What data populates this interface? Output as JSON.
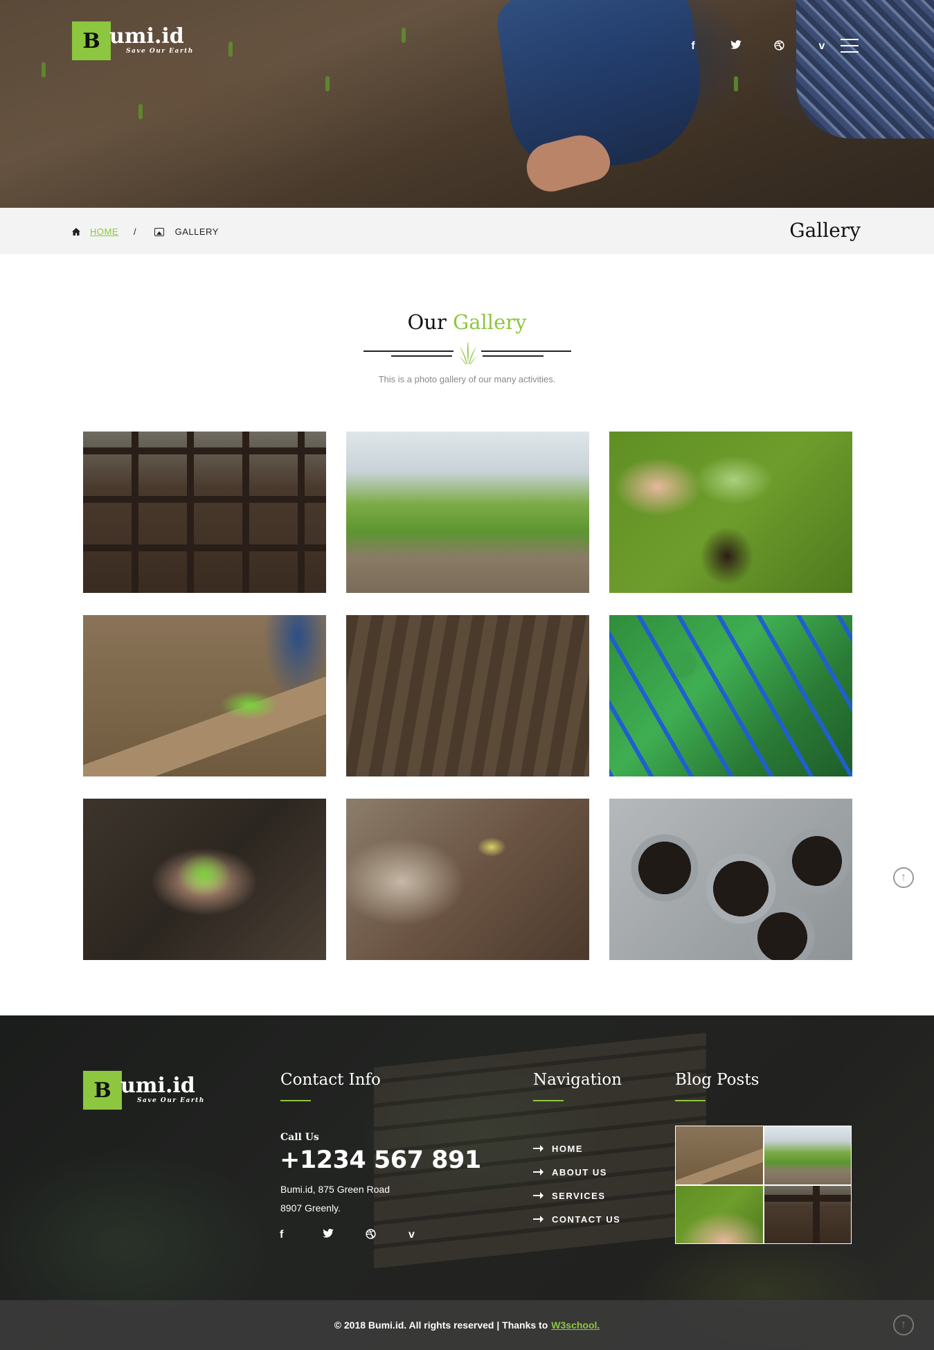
{
  "brand": {
    "letter": "B",
    "name": "umi.id",
    "tagline": "Save Our Earth"
  },
  "header": {
    "social": [
      {
        "icon": "facebook-icon",
        "glyph": "f"
      },
      {
        "icon": "twitter-icon",
        "glyph": "🐦"
      },
      {
        "icon": "dribbble-icon",
        "glyph": "⊛"
      },
      {
        "icon": "vimeo-icon",
        "glyph": "v"
      }
    ],
    "menu_icon": "hamburger-menu-icon"
  },
  "breadcrumb": {
    "home_label": "HOME",
    "separator": "/",
    "current_label": "GALLERY",
    "page_title": "Gallery"
  },
  "gallery": {
    "title_part1": "Our",
    "title_part2": "Gallery",
    "subtitle": "This is a photo gallery of our many activities.",
    "images": [
      "seedlings-in-tray",
      "soybean-field",
      "seedling-in-fingers",
      "raking-soil",
      "plowed-rows",
      "plants-in-blue-crates",
      "plant-in-hands",
      "sprouting-seed",
      "herb-pots"
    ]
  },
  "footer": {
    "contact": {
      "title": "Contact Info",
      "call_label": "Call Us",
      "phone": "+1234 567 891",
      "address_line1": "Bumi.id, 875 Green Road",
      "address_line2": "8907 Greenly."
    },
    "navigation": {
      "title": "Navigation",
      "items": [
        "HOME",
        "ABOUT US",
        "SERVICES",
        "CONTACT US"
      ]
    },
    "blog": {
      "title": "Blog Posts"
    },
    "copyright": "© 2018 Bumi.id. All rights reserved | Thanks to",
    "credit_link": "W3school."
  },
  "colors": {
    "accent": "#8dc63f"
  }
}
